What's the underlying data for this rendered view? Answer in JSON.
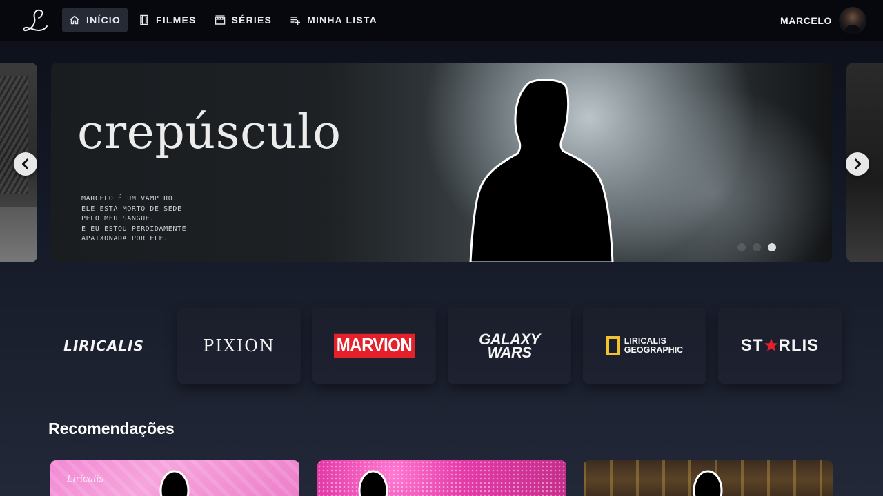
{
  "header": {
    "logo_icon": "script-l-logo-icon",
    "nav": [
      {
        "label": "INÍCIO",
        "icon": "home-icon",
        "active": true
      },
      {
        "label": "FILMES",
        "icon": "film-icon",
        "active": false
      },
      {
        "label": "SÉRIES",
        "icon": "clapperboard-icon",
        "active": false
      },
      {
        "label": "MINHA LISTA",
        "icon": "playlist-add-icon",
        "active": false
      }
    ],
    "user": {
      "name": "MARCELO",
      "avatar_icon": "avatar"
    }
  },
  "hero": {
    "title": "crepúsculo",
    "description": [
      "MARCELO É UM VAMPIRO.",
      "ELE ESTÁ MORTO DE SEDE",
      "PELO MEU SANGUE.",
      "E EU ESTOU PERDIDAMENTE",
      "APAIXONADA POR ELE."
    ],
    "slides_count": 3,
    "active_slide": 3,
    "prev_icon": "chevron-left-icon",
    "next_icon": "chevron-right-icon"
  },
  "brands": [
    {
      "name": "LIRICALIS"
    },
    {
      "name": "PIXION"
    },
    {
      "name": "MARVION"
    },
    {
      "line1": "GALAXY",
      "line2": "WARS"
    },
    {
      "line1": "LIRICALIS",
      "line2": "GEOGRAPHIC"
    },
    {
      "pre": "ST",
      "post": "RLIS"
    }
  ],
  "recommendations": {
    "title": "Recomendações",
    "cards": [
      {
        "label": "Liricalis"
      },
      {
        "label": ""
      },
      {
        "label": ""
      }
    ]
  },
  "colors": {
    "accent_red": "#e4202a",
    "geo_yellow": "#f2c12e",
    "background": "#151a28"
  }
}
